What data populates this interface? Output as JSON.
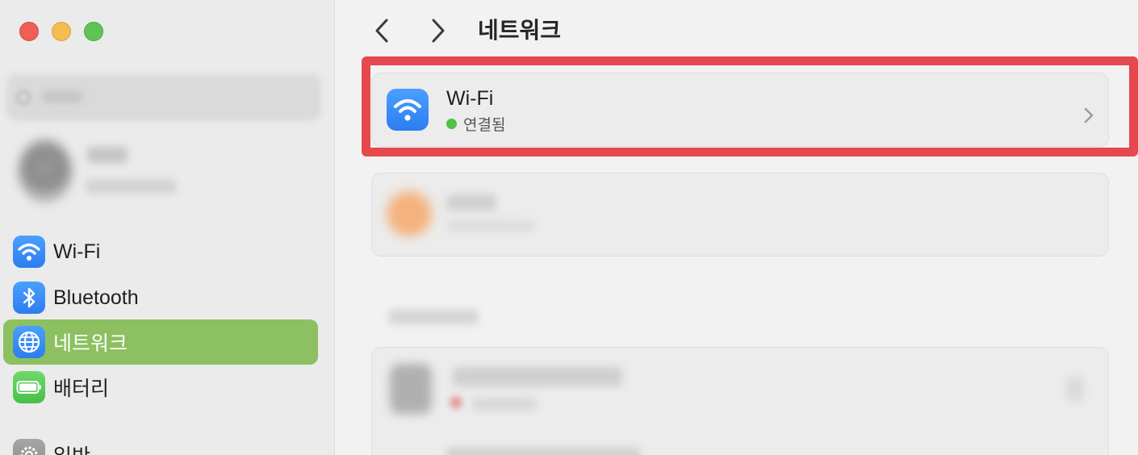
{
  "window": {
    "controls": [
      "close",
      "minimize",
      "maximize"
    ]
  },
  "sidebar": {
    "items": [
      {
        "label": "Wi-Fi",
        "icon": "wifi-icon",
        "active": false
      },
      {
        "label": "Bluetooth",
        "icon": "bluetooth-icon",
        "active": false
      },
      {
        "label": "네트워크",
        "icon": "globe-icon",
        "active": true
      },
      {
        "label": "배터리",
        "icon": "battery-icon",
        "active": false
      },
      {
        "label": "일반",
        "icon": "gear-icon",
        "active": false
      }
    ]
  },
  "header": {
    "title": "네트워크"
  },
  "wifi_card": {
    "title": "Wi-Fi",
    "status": "연결됨",
    "status_color": "#4fc24a"
  },
  "colors": {
    "accent_active": "#8cc060",
    "highlight": "#e5484d",
    "icon_blue": "#2d7df0"
  }
}
